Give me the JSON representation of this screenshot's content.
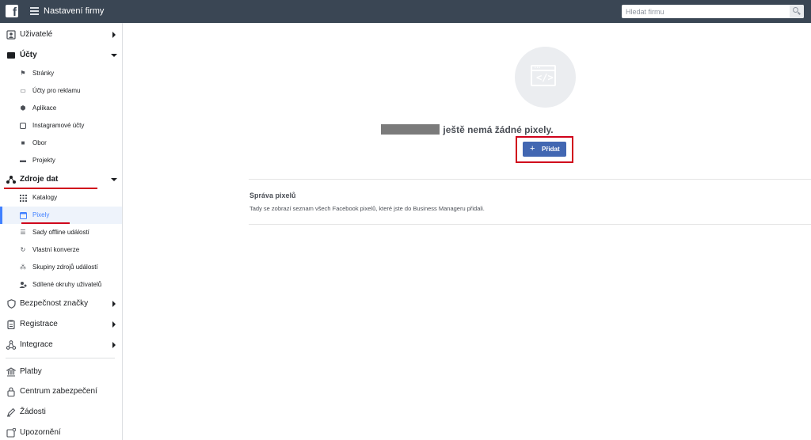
{
  "topbar": {
    "logo_letter": "f",
    "title": "Nastavení firmy",
    "search_placeholder": "Hledat firmu"
  },
  "sidebar": {
    "users": {
      "label": "Uživatelé",
      "icon": "users-icon"
    },
    "accounts": {
      "label": "Účty",
      "icon": "briefcase-icon",
      "items": [
        {
          "label": "Stránky",
          "icon": "flag-icon"
        },
        {
          "label": "Účty pro reklamu",
          "icon": "ad-account-icon"
        },
        {
          "label": "Aplikace",
          "icon": "cube-icon"
        },
        {
          "label": "Instagramové účty",
          "icon": "instagram-icon"
        },
        {
          "label": "Obor",
          "icon": "briefcase-small-icon"
        },
        {
          "label": "Projekty",
          "icon": "folder-icon"
        }
      ]
    },
    "data_sources": {
      "label": "Zdroje dat",
      "icon": "data-sources-icon",
      "items": [
        {
          "label": "Katalogy",
          "icon": "grid-icon"
        },
        {
          "label": "Pixely",
          "icon": "pixel-icon",
          "active": true
        },
        {
          "label": "Sady offline událostí",
          "icon": "stack-icon"
        },
        {
          "label": "Vlastní konverze",
          "icon": "refresh-icon"
        },
        {
          "label": "Skupiny zdrojů událostí",
          "icon": "event-group-icon"
        },
        {
          "label": "Sdílené okruhy uživatelů",
          "icon": "shared-users-icon"
        }
      ]
    },
    "brand_safety": {
      "label": "Bezpečnost značky",
      "icon": "shield-icon"
    },
    "registrations": {
      "label": "Registrace",
      "icon": "clipboard-icon"
    },
    "integrations": {
      "label": "Integrace",
      "icon": "integration-icon"
    },
    "payments": {
      "label": "Platby",
      "icon": "bank-icon"
    },
    "security_center": {
      "label": "Centrum zabezpečení",
      "icon": "lock-icon"
    },
    "requests": {
      "label": "Žádosti",
      "icon": "pen-icon"
    },
    "notifications": {
      "label": "Upozornění",
      "icon": "notification-icon"
    }
  },
  "main": {
    "empty_state": {
      "icon": "code-window-icon",
      "message": "ještě nemá žádné pixely.",
      "add_button": {
        "plus": "+",
        "label": "Přidat"
      }
    },
    "section": {
      "title": "Správa pixelů",
      "description": "Tady se zobrazí seznam všech Facebook pixelů, které jste do Business Manageru přidali."
    }
  },
  "colors": {
    "topbar": "#3a4654",
    "accent": "#4267b2",
    "active_item": "#4080ff",
    "highlight_red": "#d0021b"
  }
}
